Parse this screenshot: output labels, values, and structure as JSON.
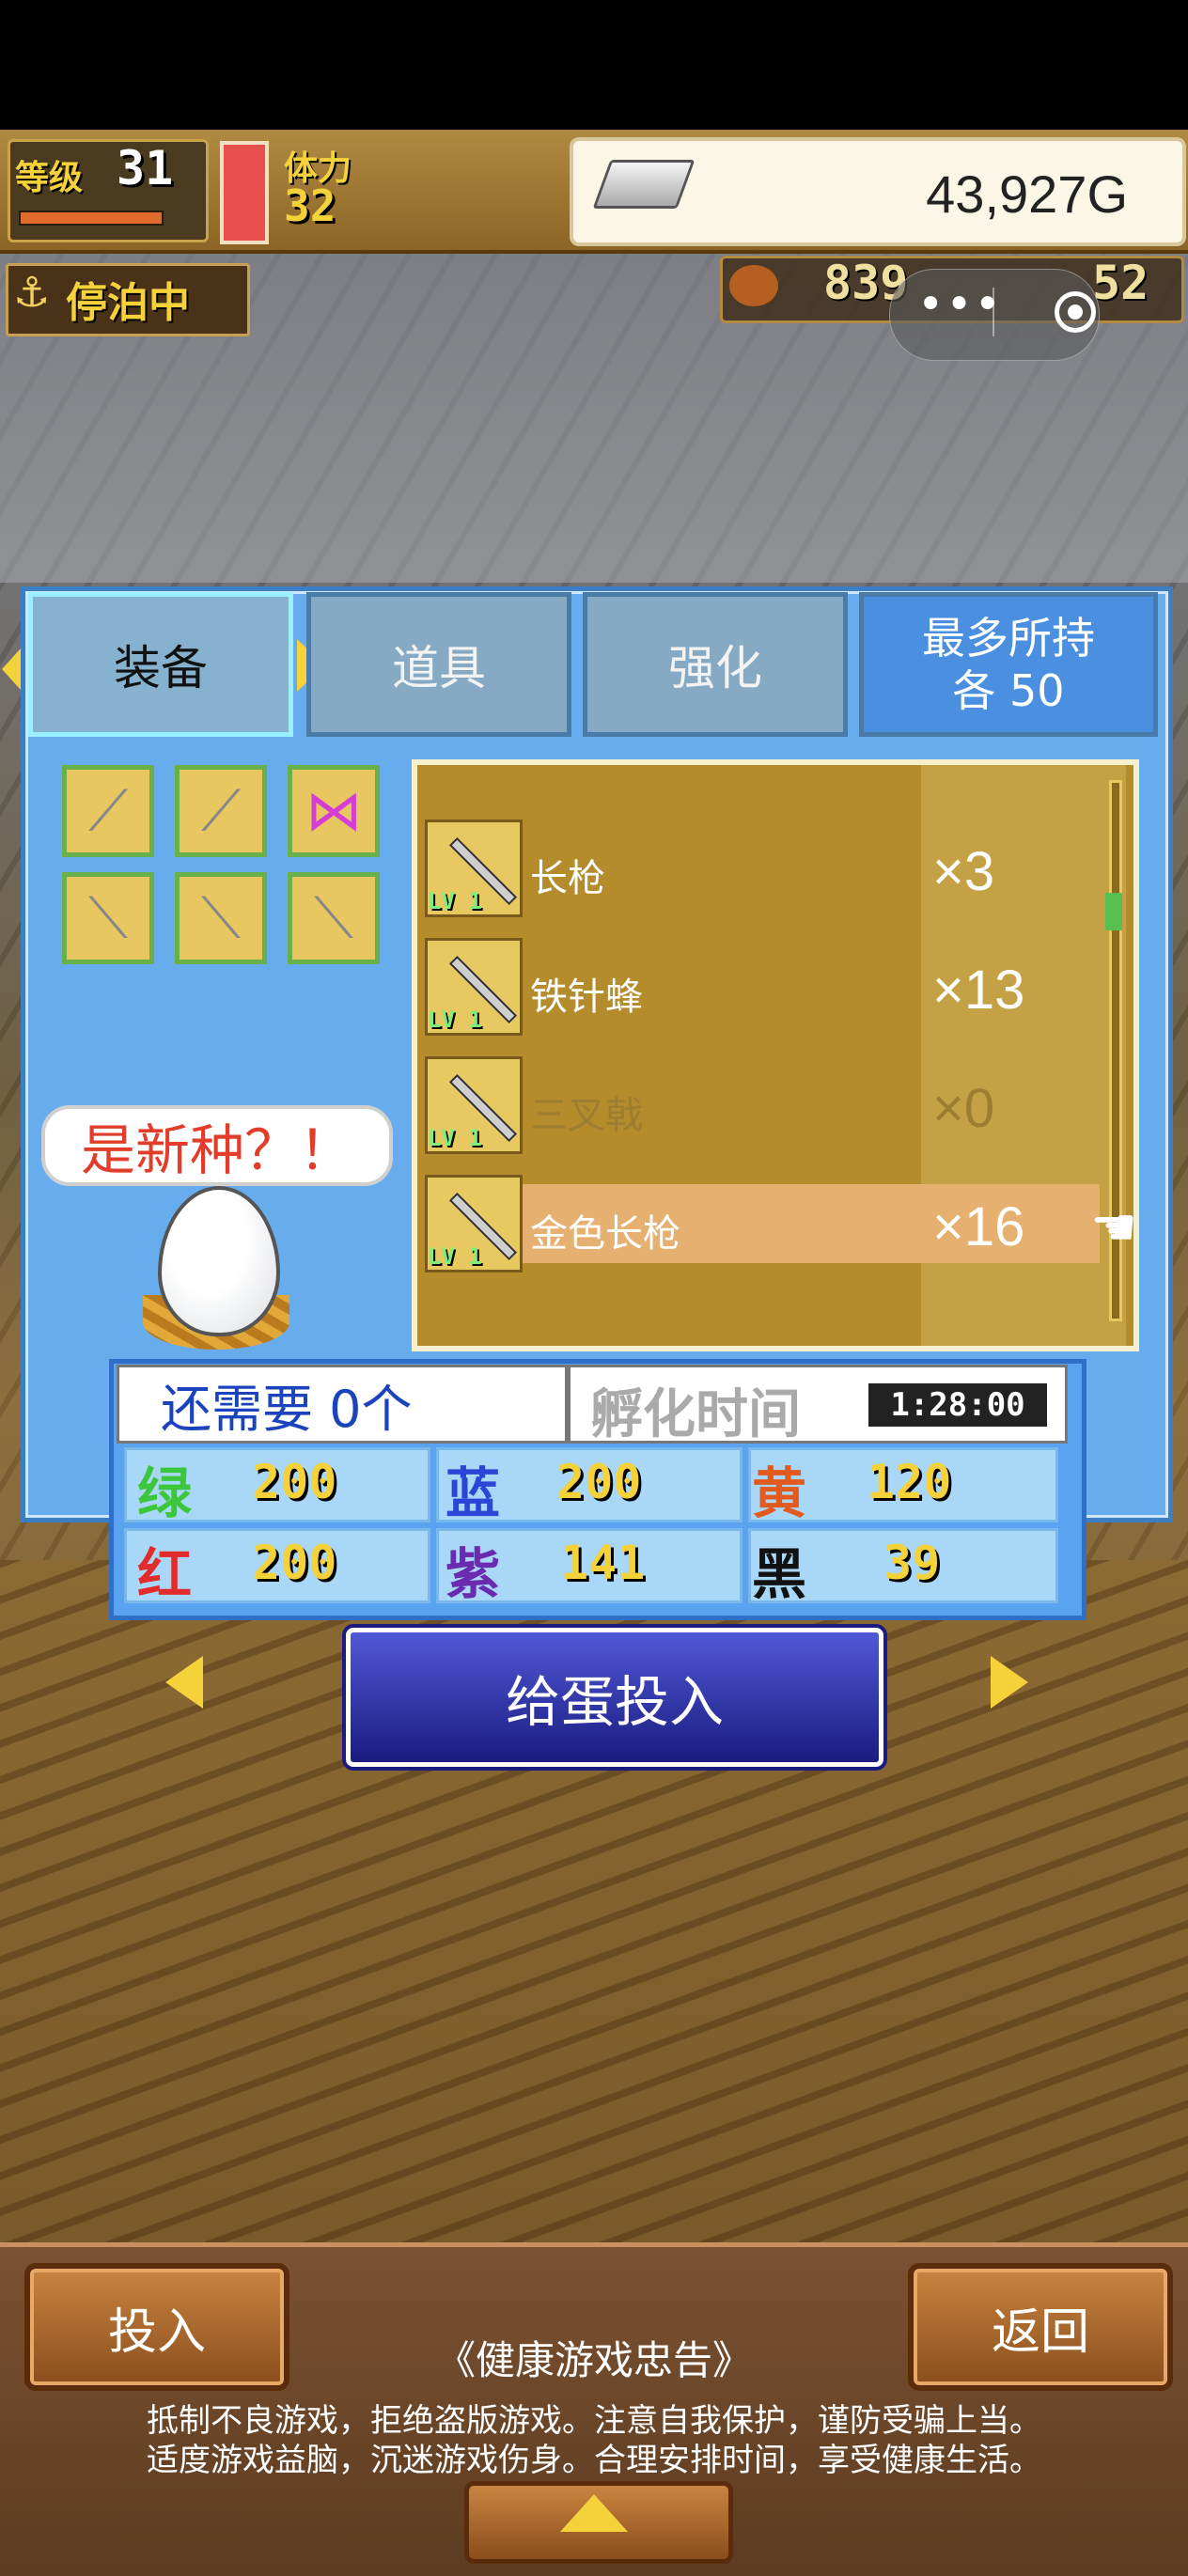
{
  "status": {
    "level_label": "等级",
    "level": "31",
    "stamina_label": "体力",
    "stamina": "32",
    "gold": "43,927G",
    "dock_label": "停泊中",
    "resource_1": "839",
    "resource_2": "52"
  },
  "tabs": {
    "equip": "装备",
    "items": "道具",
    "enhance": "强化",
    "max_hold_line1": "最多所持",
    "max_hold_line2": "各 50"
  },
  "bubble": "是新种？！",
  "list": {
    "rows": [
      {
        "name": "长枪",
        "qty": "×3",
        "lv": "LV 1"
      },
      {
        "name": "铁针蜂",
        "qty": "×13",
        "lv": "LV 1"
      },
      {
        "name": "三叉戟",
        "qty": "×0",
        "lv": "LV 1"
      },
      {
        "name": "金色长枪",
        "qty": "×16",
        "lv": "LV 1"
      }
    ]
  },
  "hatch": {
    "need": "还需要 0个",
    "hatch_label": "孵化时间",
    "hatch_time": "1:28:00",
    "colors": [
      {
        "name": "绿",
        "value": "200",
        "color": "#3cc63c"
      },
      {
        "name": "蓝",
        "value": "200",
        "color": "#2b46d6"
      },
      {
        "name": "黄",
        "value": "120",
        "color": "#e25a1e"
      },
      {
        "name": "红",
        "value": "200",
        "color": "#e22b2b"
      },
      {
        "name": "紫",
        "value": "141",
        "color": "#6a2bb0"
      },
      {
        "name": "黑",
        "value": "39",
        "color": "#111111"
      }
    ]
  },
  "action": {
    "feed": "给蛋投入"
  },
  "bottom": {
    "insert": "投入",
    "back": "返回",
    "notice_title": "《健康游戏忠告》",
    "notice_line1": "抵制不良游戏，拒绝盗版游戏。注意自我保护，谨防受骗上当。",
    "notice_line2": "适度游戏益脑，沉迷游戏伤身。合理安排时间，享受健康生活。"
  }
}
